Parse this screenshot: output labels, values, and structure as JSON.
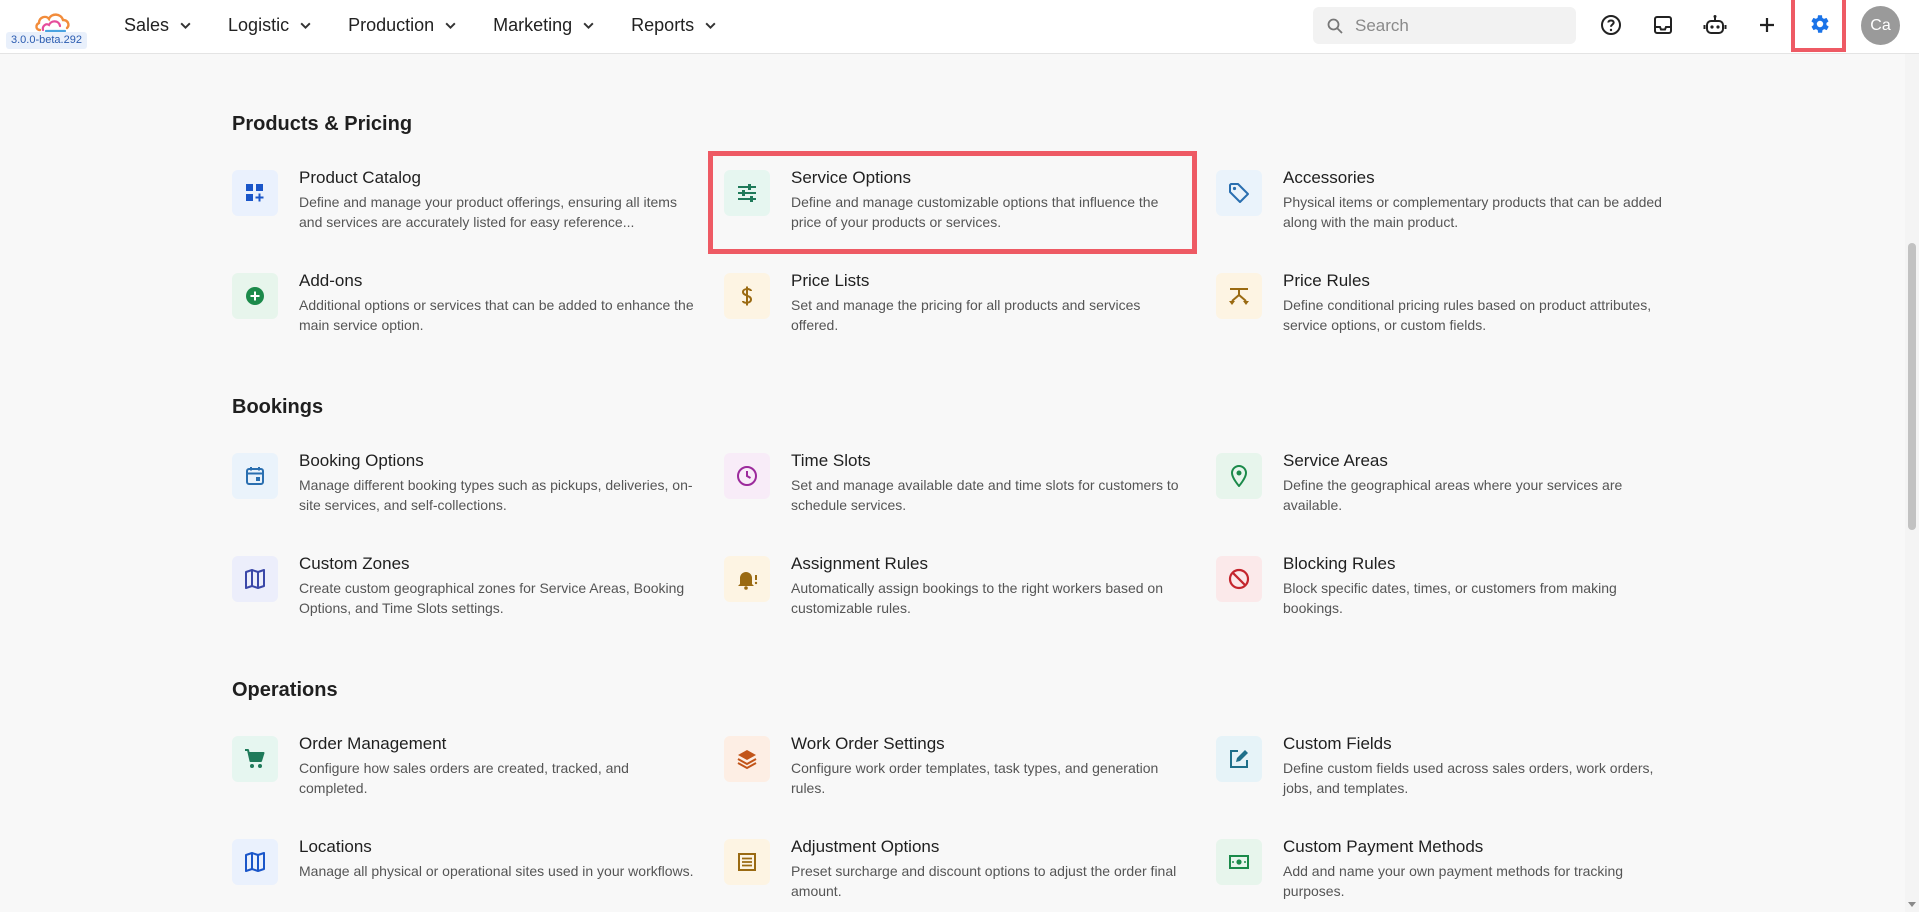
{
  "app": {
    "version": "3.0.0-beta.292"
  },
  "nav": [
    {
      "label": "Sales"
    },
    {
      "label": "Logistic"
    },
    {
      "label": "Production"
    },
    {
      "label": "Marketing"
    },
    {
      "label": "Reports"
    }
  ],
  "search": {
    "placeholder": "Search"
  },
  "avatar": {
    "initials": "Ca"
  },
  "colors": {
    "highlight": "#ee5a64",
    "settings_icon": "#1a73e8"
  },
  "sections": [
    {
      "title": "Products & Pricing",
      "items": [
        {
          "title": "Product Catalog",
          "desc": "Define and manage your product offerings, ensuring all items and services are accurately listed for easy reference...",
          "icon": "grid-plus-icon"
        },
        {
          "title": "Service Options",
          "desc": "Define and manage customizable options that influence the price of your products or services.",
          "icon": "sliders-icon"
        },
        {
          "title": "Accessories",
          "desc": "Physical items or complementary products that can be added along with the main product.",
          "icon": "tag-icon"
        },
        {
          "title": "Add-ons",
          "desc": "Additional options or services that can be added to enhance the main service option.",
          "icon": "plus-circle-icon"
        },
        {
          "title": "Price Lists",
          "desc": "Set and manage the pricing for all products and services offered.",
          "icon": "dollar-icon"
        },
        {
          "title": "Price Rules",
          "desc": "Define conditional pricing rules based on product attributes, service options, or custom fields.",
          "icon": "rules-icon"
        }
      ]
    },
    {
      "title": "Bookings",
      "items": [
        {
          "title": "Booking Options",
          "desc": "Manage different booking types such as pickups, deliveries, on-site services, and self-collections.",
          "icon": "calendar-icon"
        },
        {
          "title": "Time Slots",
          "desc": "Set and manage available date and time slots for customers to schedule services.",
          "icon": "clock-icon"
        },
        {
          "title": "Service Areas",
          "desc": "Define the geographical areas where your services are available.",
          "icon": "location-pin-icon"
        },
        {
          "title": "Custom Zones",
          "desc": "Create custom geographical zones for Service Areas, Booking Options, and Time Slots settings.",
          "icon": "map-icon"
        },
        {
          "title": "Assignment Rules",
          "desc": "Automatically assign bookings to the right workers based on customizable rules.",
          "icon": "bell-alert-icon"
        },
        {
          "title": "Blocking Rules",
          "desc": "Block specific dates, times, or customers from making bookings.",
          "icon": "block-icon"
        }
      ]
    },
    {
      "title": "Operations",
      "items": [
        {
          "title": "Order Management",
          "desc": "Configure how sales orders are created, tracked, and completed.",
          "icon": "cart-icon"
        },
        {
          "title": "Work Order Settings",
          "desc": "Configure work order templates, task types, and generation rules.",
          "icon": "layers-icon"
        },
        {
          "title": "Custom Fields",
          "desc": "Define custom fields used across sales orders, work orders, jobs, and templates.",
          "icon": "edit-box-icon"
        },
        {
          "title": "Locations",
          "desc": "Manage all physical or operational sites used in your workflows.",
          "icon": "map-icon"
        },
        {
          "title": "Adjustment Options",
          "desc": "Preset surcharge and discount options to adjust the order final amount.",
          "icon": "receipt-icon"
        },
        {
          "title": "Custom Payment Methods",
          "desc": "Add and name your own payment methods for tracking purposes.",
          "icon": "payments-icon"
        }
      ]
    }
  ]
}
